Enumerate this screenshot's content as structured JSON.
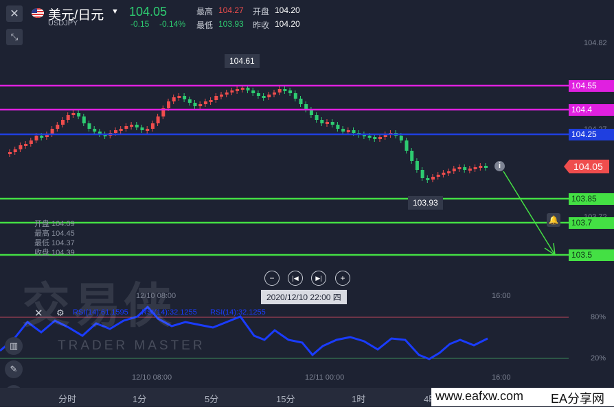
{
  "header": {
    "pair": "美元/日元",
    "symbol": "USDJPY",
    "price": "104.05",
    "change": "-0.15",
    "change_pct": "-0.14%",
    "high_label": "最高",
    "high_value": "104.27",
    "open_label": "开盘",
    "open_value": "104.20",
    "low_label": "最低",
    "low_value": "103.93",
    "prev_close_label": "昨收",
    "prev_close_value": "104.20"
  },
  "main_chart": {
    "axis_top": "104.82",
    "axis_partial_1": "104.27",
    "axis_partial_2": "103.72",
    "peak_label": "104.61",
    "trough_label": "103.93",
    "current_price_tag": "104.05",
    "levels": [
      {
        "label": "104.55",
        "color": "#e020e0"
      },
      {
        "label": "104.4",
        "color": "#e020e0"
      },
      {
        "label": "104.25",
        "color": "#1f3fe0"
      },
      {
        "label": "103.85",
        "color": "#33e033"
      },
      {
        "label": "103.7",
        "color": "#33e033"
      },
      {
        "label": "103.5",
        "color": "#33e033"
      }
    ],
    "ohlc": {
      "open": "开盘 104.09",
      "high": "最高 104.45",
      "low": "最低 104.37",
      "close": "收盘 104.39"
    },
    "time_left": "12/10 08:00",
    "time_right": "16:00",
    "cursor_date": "2020/12/10 22:00 四"
  },
  "rsi_panel": {
    "legend": [
      "RSI(14):61.1595",
      "RSI(14):32.1255",
      "RSI(14):32.1255"
    ],
    "level_80": "80%",
    "level_20": "20%",
    "time_labels": [
      "12/10 08:00",
      "12/11 00:00",
      "16:00"
    ]
  },
  "watermark": {
    "main": "交易侠",
    "sub": "TRADER MASTER"
  },
  "bottom_tabs": [
    "分时",
    "1分",
    "5分",
    "15分",
    "1时",
    "4时"
  ],
  "footer": {
    "site": "www.eafxw.com",
    "brand": "EA分享网"
  }
}
